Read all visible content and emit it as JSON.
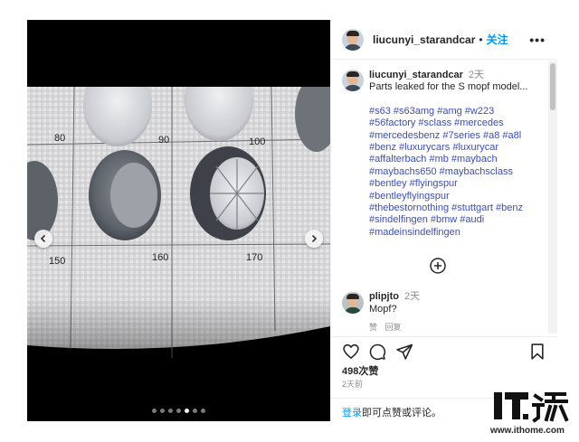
{
  "post": {
    "username": "liucunyi_starandcar",
    "separator": "•",
    "follow_label": "关注",
    "more_label": "•••",
    "caption_time": "2天",
    "caption_text": "Parts leaked for the S mopf model...",
    "hashtag_lines": [
      "#s63 #s63amg #amg #w223",
      "#56factory #sclass #mercedes",
      "#mercedesbenz #7series #a8 #a8l",
      "#benz #luxurycars #luxurycar",
      "#affalterbach #mb #maybach",
      "#maybachs650 #maybachsclass",
      "#bentley #flyingspur",
      "#bentleyflyingspur",
      "#thebestornothing #stuttgart #benz",
      "#sindelfingen #bmw #audi",
      "#madeinsindelfingen"
    ],
    "comment": {
      "username": "plipjto",
      "time": "2天",
      "text": "Mopf?",
      "like_label": "赞",
      "reply_label": "回复"
    },
    "likes": "498次赞",
    "date": "2天前",
    "login_link": "登录",
    "login_text": "即可点赞或评论。"
  },
  "media": {
    "wheel_labels": [
      "80",
      "90",
      "100",
      "150",
      "160",
      "170"
    ],
    "carousel_count": 7,
    "carousel_active": 4
  },
  "watermark": {
    "url": "www.ithome.com"
  },
  "icons": [
    "more-options-icon",
    "chevron-left-icon",
    "chevron-right-icon",
    "plus-circle-icon",
    "heart-icon",
    "comment-icon",
    "share-icon",
    "bookmark-icon",
    "ithome-logo-icon"
  ],
  "colors": {
    "link": "#0095f6",
    "hashtag": "#3c4db8",
    "muted": "#8e8e8e",
    "text": "#262626"
  }
}
